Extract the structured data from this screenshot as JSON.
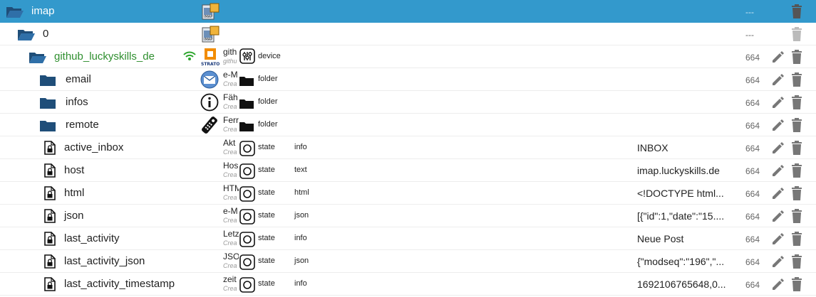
{
  "colors": {
    "selected_bg": "#3399cc",
    "folder": "#1f4e79",
    "adapter_text": "#2f8f2f",
    "icon_gray": "#777777"
  },
  "rows": [
    {
      "name": "imap",
      "title": "",
      "subtitle": "",
      "type": "",
      "role": "",
      "value": "",
      "perm": "---",
      "icon": "folder-open-icon",
      "obj_icon": "imap-adapter-icon"
    },
    {
      "name": "0",
      "title": "",
      "subtitle": "",
      "type": "",
      "role": "",
      "value": "",
      "perm": "---",
      "icon": "folder-open-icon",
      "obj_icon": "imap-adapter-icon"
    },
    {
      "name": "github_luckyskills_de",
      "title": "gith",
      "subtitle": "githu",
      "type": "device",
      "role": "",
      "value": "",
      "perm": "664",
      "icon": "folder-open-icon",
      "obj_icon": "strato-icon"
    },
    {
      "name": "email",
      "title": "e-M",
      "subtitle": "Crea",
      "type": "folder",
      "role": "",
      "value": "",
      "perm": "664",
      "icon": "folder-icon",
      "obj_icon": "mail-icon"
    },
    {
      "name": "infos",
      "title": "Fäh",
      "subtitle": "Crea",
      "type": "folder",
      "role": "",
      "value": "",
      "perm": "664",
      "icon": "folder-icon",
      "obj_icon": "info-icon"
    },
    {
      "name": "remote",
      "title": "Ferr",
      "subtitle": "Crea",
      "type": "folder",
      "role": "",
      "value": "",
      "perm": "664",
      "icon": "folder-icon",
      "obj_icon": "remote-control-icon"
    },
    {
      "name": "active_inbox",
      "title": "Akt",
      "subtitle": "Crea",
      "type": "state",
      "role": "info",
      "value": "INBOX",
      "perm": "664",
      "icon": "file-lock-icon",
      "obj_icon": ""
    },
    {
      "name": "host",
      "title": "Hos",
      "subtitle": "Crea",
      "type": "state",
      "role": "text",
      "value": "imap.luckyskills.de",
      "perm": "664",
      "icon": "file-lock-icon",
      "obj_icon": ""
    },
    {
      "name": "html",
      "title": "HTM",
      "subtitle": "Crea",
      "type": "state",
      "role": "html",
      "value": "<!DOCTYPE html...",
      "perm": "664",
      "icon": "file-lock-icon",
      "obj_icon": ""
    },
    {
      "name": "json",
      "title": "e-M",
      "subtitle": "Crea",
      "type": "state",
      "role": "json",
      "value": "[{\"id\":1,\"date\":\"15....",
      "perm": "664",
      "icon": "file-lock-icon",
      "obj_icon": ""
    },
    {
      "name": "last_activity",
      "title": "Letz",
      "subtitle": "Crea",
      "type": "state",
      "role": "info",
      "value": "Neue Post",
      "perm": "664",
      "icon": "file-lock-icon",
      "obj_icon": ""
    },
    {
      "name": "last_activity_json",
      "title": "JSO",
      "subtitle": "Crea",
      "type": "state",
      "role": "json",
      "value": "{\"modseq\":\"196\",\"...",
      "perm": "664",
      "icon": "file-lock-icon",
      "obj_icon": ""
    },
    {
      "name": "last_activity_timestamp",
      "title": "zeit",
      "subtitle": "Crea",
      "type": "state",
      "role": "info",
      "value": "1692106765648,0...",
      "perm": "664",
      "icon": "file-lock-icon",
      "obj_icon": ""
    }
  ]
}
